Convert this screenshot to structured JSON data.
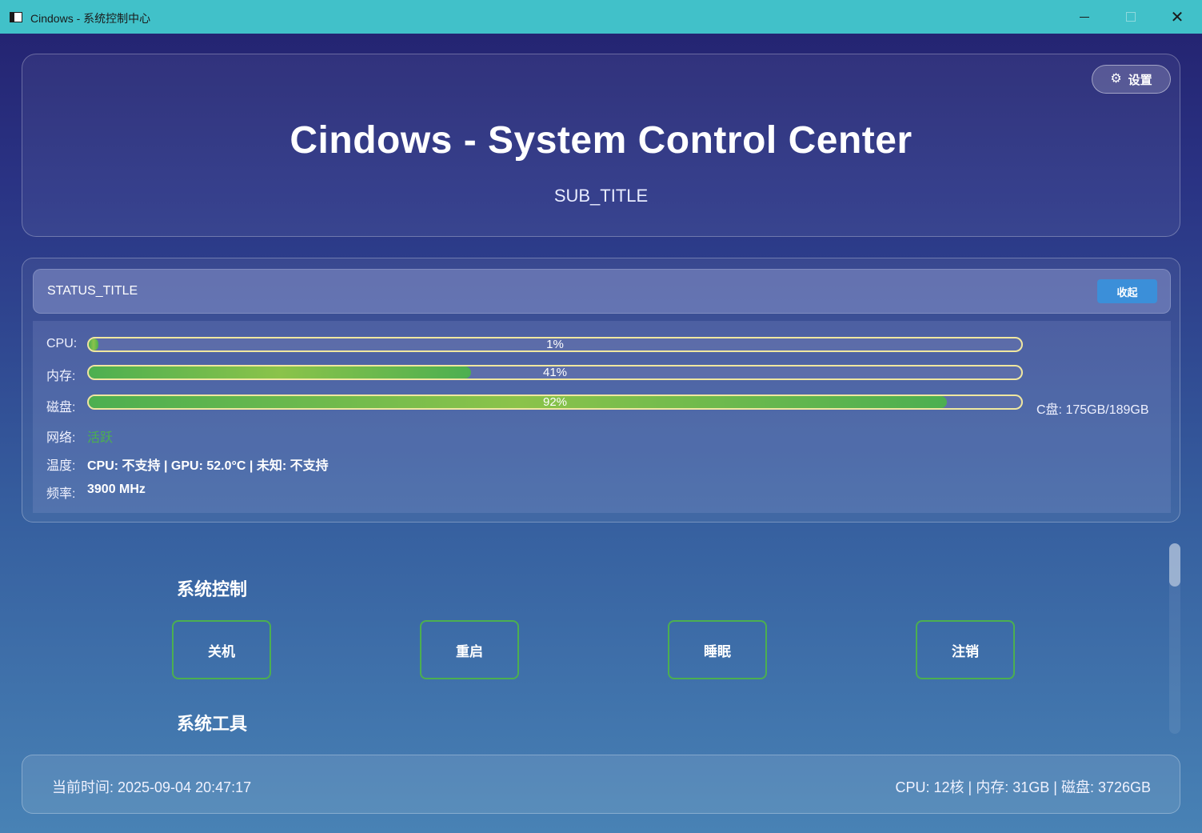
{
  "window": {
    "title": "Cindows - 系统控制中心",
    "minimize_label": "",
    "maximize_label": "",
    "close_label": "✕"
  },
  "header": {
    "settings_icon": "⚙",
    "settings_label": "设置",
    "title": "Cindows - System Control Center",
    "subtitle": "SUB_TITLE"
  },
  "status": {
    "title": "STATUS_TITLE",
    "collapse_label": "收起",
    "cpu": {
      "label": "CPU:",
      "percent": 1,
      "text": "1%"
    },
    "memory": {
      "label": "内存:",
      "percent": 41,
      "text": "41%"
    },
    "disk": {
      "label": "磁盘:",
      "percent": 92,
      "text": "92%",
      "info": "C盘: 175GB/189GB"
    },
    "network": {
      "label": "网络:",
      "value": "活跃"
    },
    "temperature": {
      "label": "温度:",
      "value": "CPU: 不支持 | GPU: 52.0°C | 未知: 不支持"
    },
    "frequency": {
      "label": "频率:",
      "value": "3900 MHz"
    }
  },
  "system_control": {
    "title": "系统控制",
    "buttons": [
      "关机",
      "重启",
      "睡眠",
      "注销"
    ]
  },
  "system_tools": {
    "title": "系统工具"
  },
  "footer": {
    "time": "当前时间: 2025-09-04 20:47:17",
    "specs": "CPU: 12核 | 内存: 31GB | 磁盘: 3726GB"
  },
  "colors": {
    "titlebar": "#41c1c9",
    "accent_green": "#4caf50",
    "collapse_button": "#3b8fd9",
    "bar_border": "#f0e7a0"
  }
}
